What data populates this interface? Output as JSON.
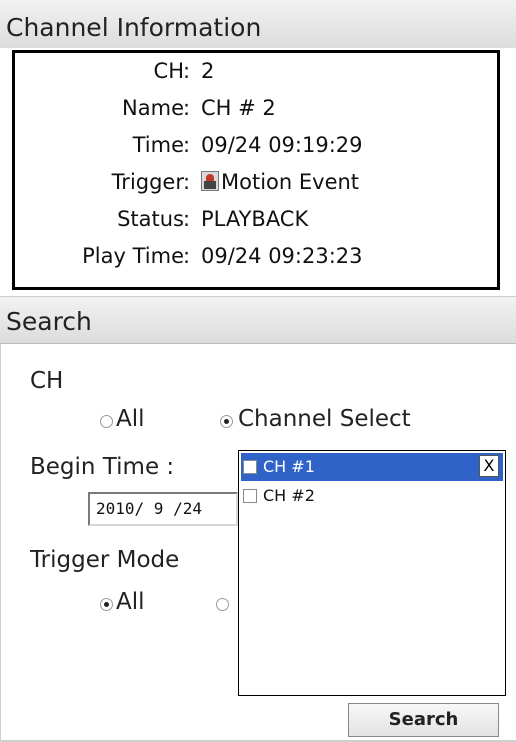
{
  "channel_info": {
    "header": "Channel Information",
    "rows": [
      {
        "label": "CH",
        "value": "2"
      },
      {
        "label": "Name",
        "value": "CH # 2"
      },
      {
        "label": "Time",
        "value": "09/24 09:19:29"
      },
      {
        "label": "Trigger",
        "value": "Motion Event",
        "icon": "motion-event-icon"
      },
      {
        "label": "Status",
        "value": "PLAYBACK"
      },
      {
        "label": "Play Time",
        "value": "09/24 09:23:23"
      }
    ]
  },
  "search": {
    "header": "Search",
    "ch_label": "CH",
    "ch_options": [
      {
        "label": "All",
        "checked": false
      },
      {
        "label": "Channel Select",
        "checked": true
      }
    ],
    "begin_time_label": "Begin Time :",
    "begin_date_value": "2010/ 9 /24",
    "trigger_mode_label": "Trigger Mode",
    "trigger_options": [
      {
        "label": "All",
        "checked": true
      },
      {
        "label": "",
        "checked": false
      }
    ],
    "button_label": "Search"
  },
  "channel_dropdown": {
    "items": [
      {
        "label": "CH #1",
        "selected": true,
        "checked": false
      },
      {
        "label": "CH #2",
        "selected": false,
        "checked": false
      }
    ],
    "close_label": "X"
  },
  "colors": {
    "selection": "#2f63c7",
    "header_gradient_top": "#f2f2f2",
    "header_gradient_bottom": "#dcdcdc"
  }
}
